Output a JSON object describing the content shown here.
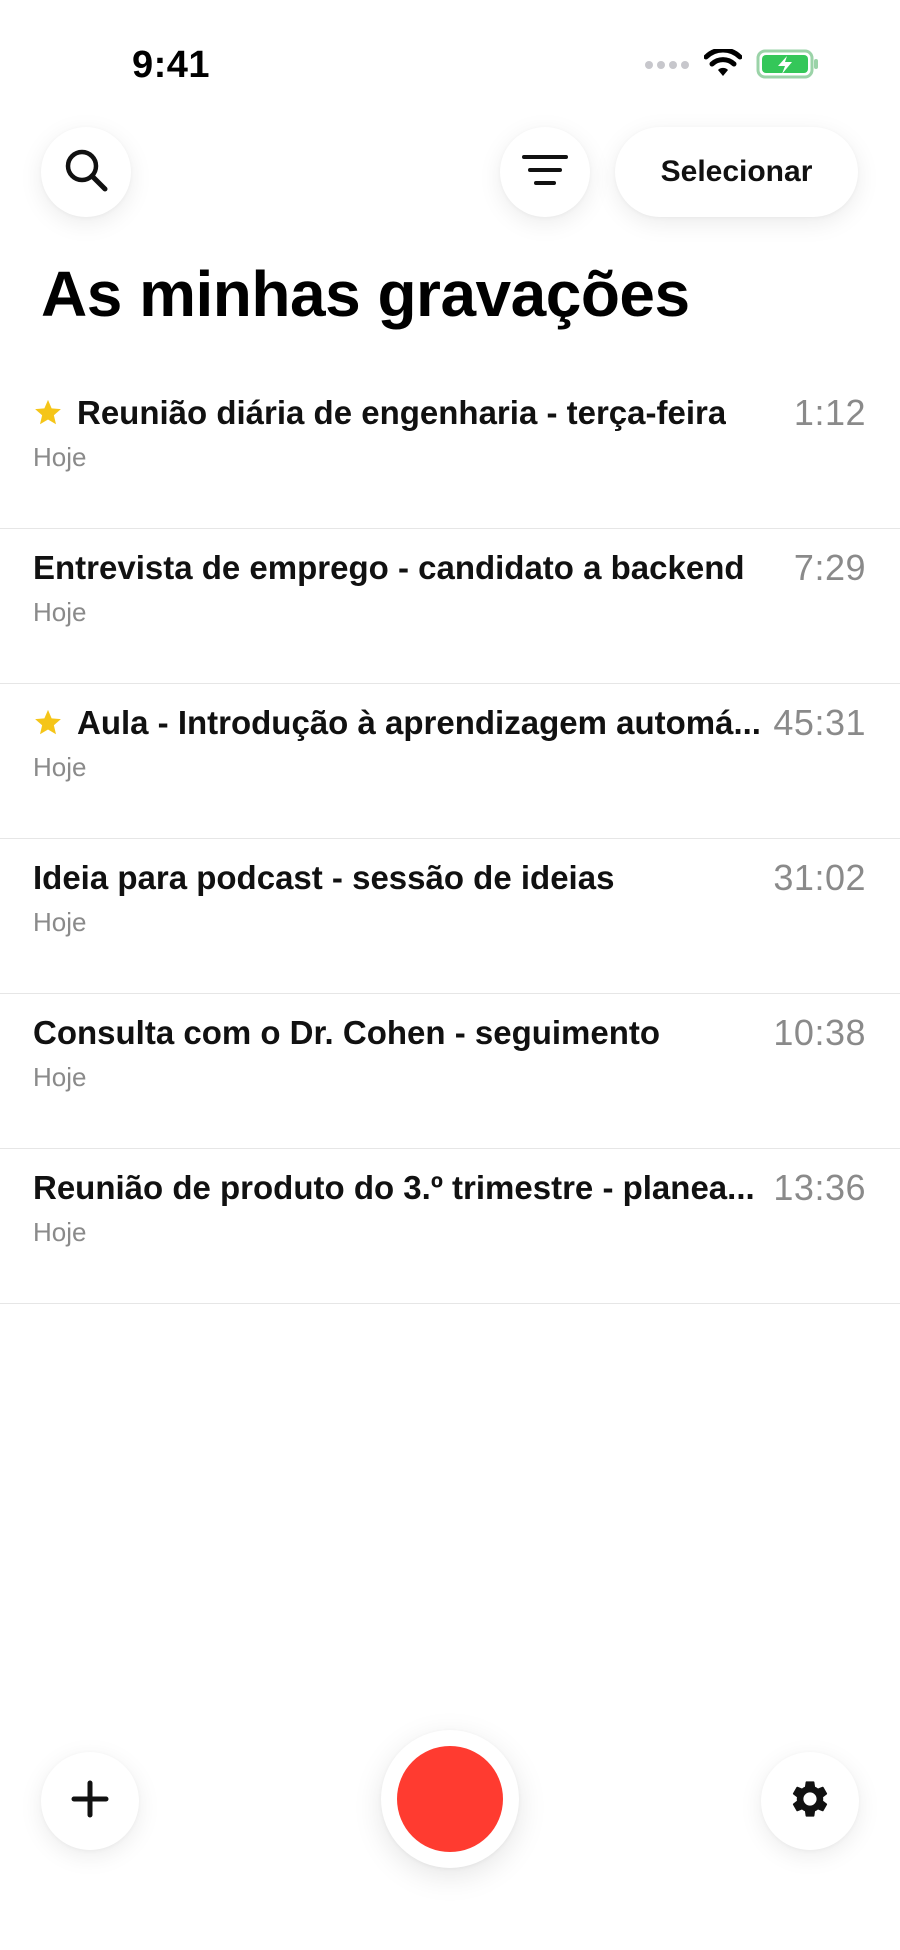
{
  "status_bar": {
    "time": "9:41",
    "signal_icon": "cellular-signal-icon",
    "wifi_icon": "wifi-icon",
    "battery_icon": "battery-charging-icon",
    "battery_color": "#34c759"
  },
  "toolbar": {
    "search_icon": "search-icon",
    "filter_icon": "filter-icon",
    "select_label": "Selecionar"
  },
  "page": {
    "title": "As minhas gravações"
  },
  "recordings": [
    {
      "title": "Reunião diária de engenharia - terça-feira",
      "date": "Hoje",
      "duration": "1:12",
      "starred": true
    },
    {
      "title": "Entrevista de emprego - candidato a backend",
      "date": "Hoje",
      "duration": "7:29",
      "starred": false
    },
    {
      "title": "Aula - Introdução à aprendizagem automá...",
      "date": "Hoje",
      "duration": "45:31",
      "starred": true
    },
    {
      "title": "Ideia para podcast - sessão de ideias",
      "date": "Hoje",
      "duration": "31:02",
      "starred": false
    },
    {
      "title": "Consulta com o Dr. Cohen - seguimento",
      "date": "Hoje",
      "duration": "10:38",
      "starred": false
    },
    {
      "title": "Reunião de produto do 3.º trimestre - planea...",
      "date": "Hoje",
      "duration": "13:36",
      "starred": false
    }
  ],
  "bottom_bar": {
    "add_icon": "plus-icon",
    "record_icon": "record-icon",
    "record_color": "#ff3b30",
    "settings_icon": "gear-icon"
  },
  "colors": {
    "star": "#f5c518",
    "secondary_text": "#8a8a8a"
  }
}
